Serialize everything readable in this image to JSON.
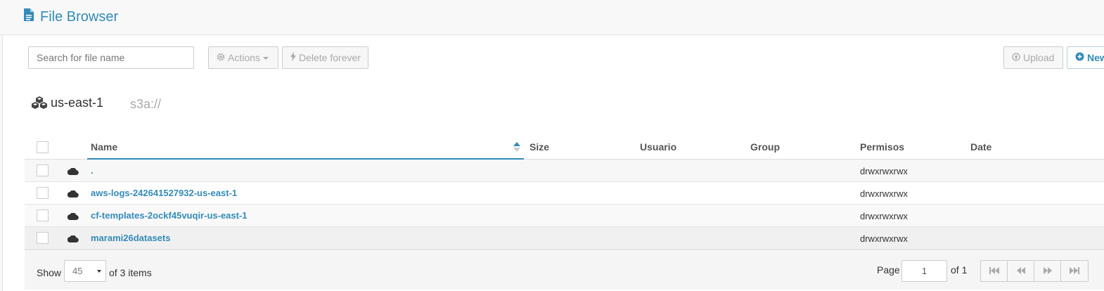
{
  "app": {
    "title": "File Browser",
    "icon": "file-icon"
  },
  "toolbar": {
    "search_placeholder": "Search for file name",
    "actions_label": "Actions",
    "delete_label": "Delete forever",
    "upload_label": "Upload",
    "new_label": "New"
  },
  "breadcrumb": {
    "root": "us-east-1",
    "path": "s3a://"
  },
  "table": {
    "columns": [
      "Name",
      "Size",
      "Usuario",
      "Group",
      "Permisos",
      "Date"
    ],
    "sort": {
      "column": "Name",
      "direction": "asc"
    },
    "rows": [
      {
        "name": ".",
        "permissions": "drwxrwxrwx"
      },
      {
        "name": "aws-logs-242641527932-us-east-1",
        "permissions": "drwxrwxrwx"
      },
      {
        "name": "cf-templates-2ockf45vuqir-us-east-1",
        "permissions": "drwxrwxrwx"
      },
      {
        "name": "marami26datasets",
        "permissions": "drwxrwxrwx"
      }
    ]
  },
  "footer": {
    "show_label": "Show",
    "page_size": "45",
    "items_text": "of 3 items",
    "page_label": "Page",
    "page_value": "1",
    "of_pages": "of 1"
  },
  "colors": {
    "accent": "#338bb8",
    "muted": "#aaaaaa"
  }
}
